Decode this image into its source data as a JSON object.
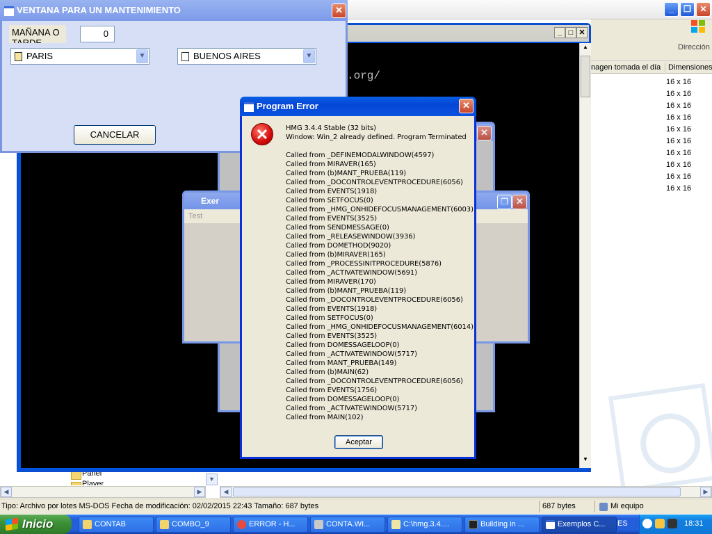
{
  "explorer": {
    "address_label": "Dirección",
    "col_headers": [
      "nagen tomada el día",
      "Dimensiones"
    ],
    "dims": [
      "16 x 16",
      "16 x 16",
      "16 x 16",
      "16 x 16",
      "16 x 16",
      "16 x 16",
      "16 x 16",
      "16 x 16",
      "16 x 16",
      "16 x 16"
    ],
    "tree": [
      "Panel",
      "Player"
    ],
    "status": {
      "type_text": "Tipo: Archivo por lotes MS-DOS Fecha de modificación: 02/02/2015 22:43 Tamaño: 687 bytes",
      "size": "687 bytes",
      "location": "Mi equipo"
    }
  },
  "console": {
    "visible_text": ".org/"
  },
  "exemplos_window": {
    "title": "Exer",
    "menu_item": "Test"
  },
  "maintenance_window": {
    "title": "VENTANA PARA UN MANTENIMIENTO",
    "label": "MAÑANA O TARDE",
    "input_value": "0",
    "combo1": "PARIS",
    "combo2": "BUENOS AIRES",
    "cancel_label": "CANCELAR"
  },
  "error_dialog": {
    "title": "Program Error",
    "header_lines": [
      "HMG 3.4.4 Stable (32 bits)",
      "Window: Win_2 already defined. Program Terminated"
    ],
    "call_stack": [
      "Called from _DEFINEMODALWINDOW(4597)",
      "Called from MIRAVER(165)",
      "Called from (b)MANT_PRUEBA(119)",
      "Called from _DOCONTROLEVENTPROCEDURE(6056)",
      "Called from EVENTS(1918)",
      "Called from SETFOCUS(0)",
      "Called from _HMG_ONHIDEFOCUSMANAGEMENT(6003)",
      "Called from EVENTS(3525)",
      "Called from SENDMESSAGE(0)",
      "Called from _RELEASEWINDOW(3936)",
      "Called from DOMETHOD(9020)",
      "Called from (b)MIRAVER(165)",
      "Called from _PROCESSINITPROCEDURE(5876)",
      "Called from _ACTIVATEWINDOW(5691)",
      "Called from MIRAVER(170)",
      "Called from (b)MANT_PRUEBA(119)",
      "Called from _DOCONTROLEVENTPROCEDURE(6056)",
      "Called from EVENTS(1918)",
      "Called from SETFOCUS(0)",
      "Called from _HMG_ONHIDEFOCUSMANAGEMENT(6014)",
      "Called from EVENTS(3525)",
      "Called from DOMESSAGELOOP(0)",
      "Called from _ACTIVATEWINDOW(5717)",
      "Called from MANT_PRUEBA(149)",
      "Called from (b)MAIN(62)",
      "Called from _DOCONTROLEVENTPROCEDURE(6056)",
      "Called from EVENTS(1756)",
      "Called from DOMESSAGELOOP(0)",
      "Called from _ACTIVATEWINDOW(5717)",
      "Called from MAIN(102)"
    ],
    "ok_label": "Aceptar"
  },
  "taskbar": {
    "start_label": "Inicio",
    "tasks": [
      {
        "label": "CONTAB",
        "color": "#f3d36b"
      },
      {
        "label": "COMBO_9",
        "color": "#f3d36b"
      },
      {
        "label": "ERROR - H...",
        "color": "#e84a3d"
      },
      {
        "label": "CONTA.WI...",
        "color": "#c9c9c9"
      },
      {
        "label": "C:\\hmg.3.4....",
        "color": "#f0e6a4"
      },
      {
        "label": "Building in ...",
        "color": "#222222"
      },
      {
        "label": "Exemplos C...",
        "color": "#f3d36b"
      }
    ],
    "language": "ES",
    "clock": "18:31"
  }
}
